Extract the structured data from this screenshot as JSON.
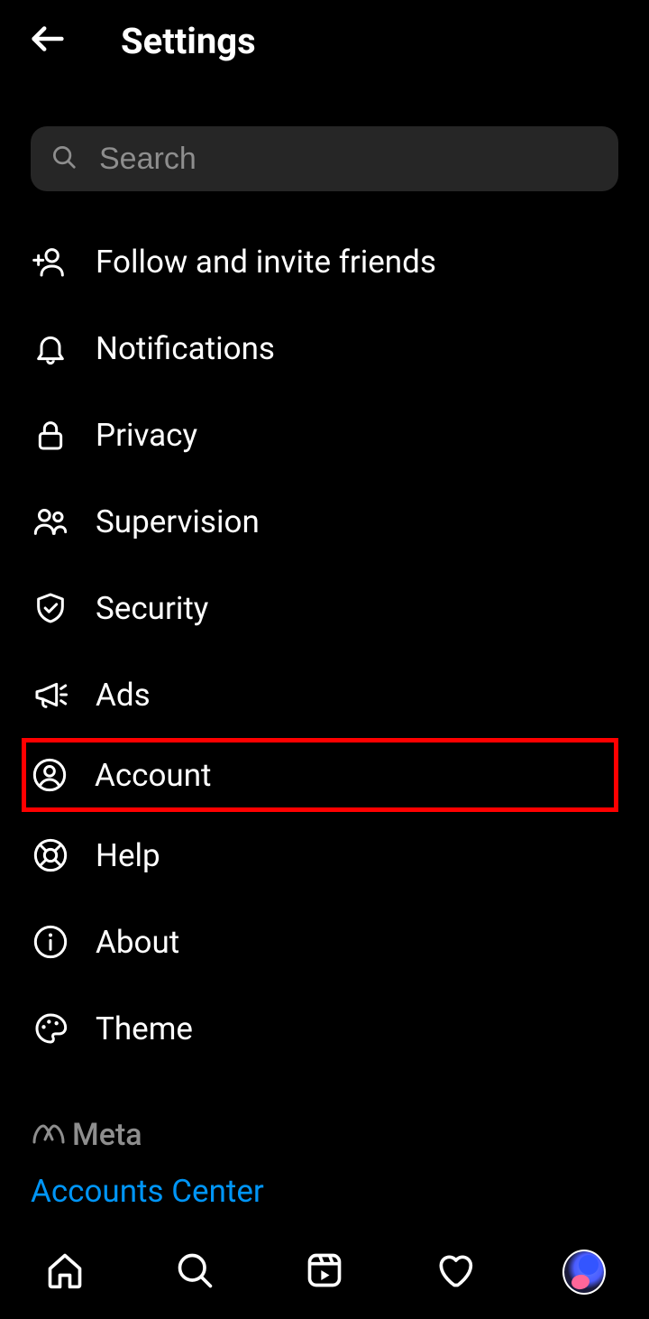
{
  "header": {
    "title": "Settings"
  },
  "search": {
    "placeholder": "Search",
    "value": ""
  },
  "menu": [
    {
      "id": "follow-invite",
      "label": "Follow and invite friends",
      "icon": "person-add-icon",
      "highlighted": false
    },
    {
      "id": "notifications",
      "label": "Notifications",
      "icon": "bell-icon",
      "highlighted": false
    },
    {
      "id": "privacy",
      "label": "Privacy",
      "icon": "lock-icon",
      "highlighted": false
    },
    {
      "id": "supervision",
      "label": "Supervision",
      "icon": "people-icon",
      "highlighted": false
    },
    {
      "id": "security",
      "label": "Security",
      "icon": "shield-check-icon",
      "highlighted": false
    },
    {
      "id": "ads",
      "label": "Ads",
      "icon": "megaphone-icon",
      "highlighted": false
    },
    {
      "id": "account",
      "label": "Account",
      "icon": "account-circle-icon",
      "highlighted": true
    },
    {
      "id": "help",
      "label": "Help",
      "icon": "lifebuoy-icon",
      "highlighted": false
    },
    {
      "id": "about",
      "label": "About",
      "icon": "info-icon",
      "highlighted": false
    },
    {
      "id": "theme",
      "label": "Theme",
      "icon": "palette-icon",
      "highlighted": false
    }
  ],
  "footer": {
    "meta_label": "Meta",
    "accounts_center_label": "Accounts Center"
  }
}
